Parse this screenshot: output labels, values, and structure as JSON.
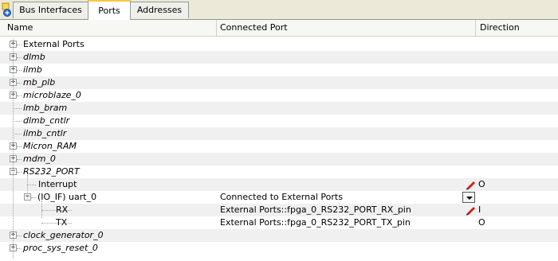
{
  "tabs": [
    {
      "label": "Bus Interfaces",
      "active": false
    },
    {
      "label": "Ports",
      "active": true
    },
    {
      "label": "Addresses",
      "active": false
    }
  ],
  "columns": {
    "name": "Name",
    "connected": "Connected Port",
    "direction": "Direction"
  },
  "rows": [
    {
      "name": "External Ports",
      "italic": false,
      "expander": "+"
    },
    {
      "name": "dlmb",
      "italic": true,
      "expander": "+"
    },
    {
      "name": "ilmb",
      "italic": true,
      "expander": "+"
    },
    {
      "name": "mb_plb",
      "italic": true,
      "expander": "+"
    },
    {
      "name": "microblaze_0",
      "italic": true,
      "expander": "+"
    },
    {
      "name": "lmb_bram",
      "italic": true,
      "expander": ""
    },
    {
      "name": "dlmb_cntlr",
      "italic": true,
      "expander": ""
    },
    {
      "name": "ilmb_cntlr",
      "italic": true,
      "expander": ""
    },
    {
      "name": "Micron_RAM",
      "italic": true,
      "expander": "+"
    },
    {
      "name": "mdm_0",
      "italic": true,
      "expander": "+"
    },
    {
      "name": "RS232_PORT",
      "italic": true,
      "expander": "−"
    },
    {
      "name": "Interrupt",
      "italic": false,
      "expander": "",
      "connected": "",
      "direction": "O"
    },
    {
      "name": "(IO_IF) uart_0",
      "italic": false,
      "expander": "−",
      "connected": "Connected to External Ports",
      "direction": ""
    },
    {
      "name": "RX",
      "italic": false,
      "expander": "",
      "connected": "External Ports::fpga_0_RS232_PORT_RX_pin",
      "direction": "I"
    },
    {
      "name": "TX",
      "italic": false,
      "expander": "",
      "connected": "External Ports::fpga_0_RS232_PORT_TX_pin",
      "direction": "O"
    },
    {
      "name": "clock_generator_0",
      "italic": true,
      "expander": "+"
    },
    {
      "name": "proc_sys_reset_0",
      "italic": true,
      "expander": "+"
    }
  ],
  "icons": {
    "corner": "add-port-icon",
    "edit": "pencil-icon",
    "dropdown": "dropdown-arrow-icon"
  },
  "colors": {
    "active_tab_highlight": "#ffc83c",
    "alt_row": "#f0f0f0",
    "pencil": "#d02010"
  }
}
